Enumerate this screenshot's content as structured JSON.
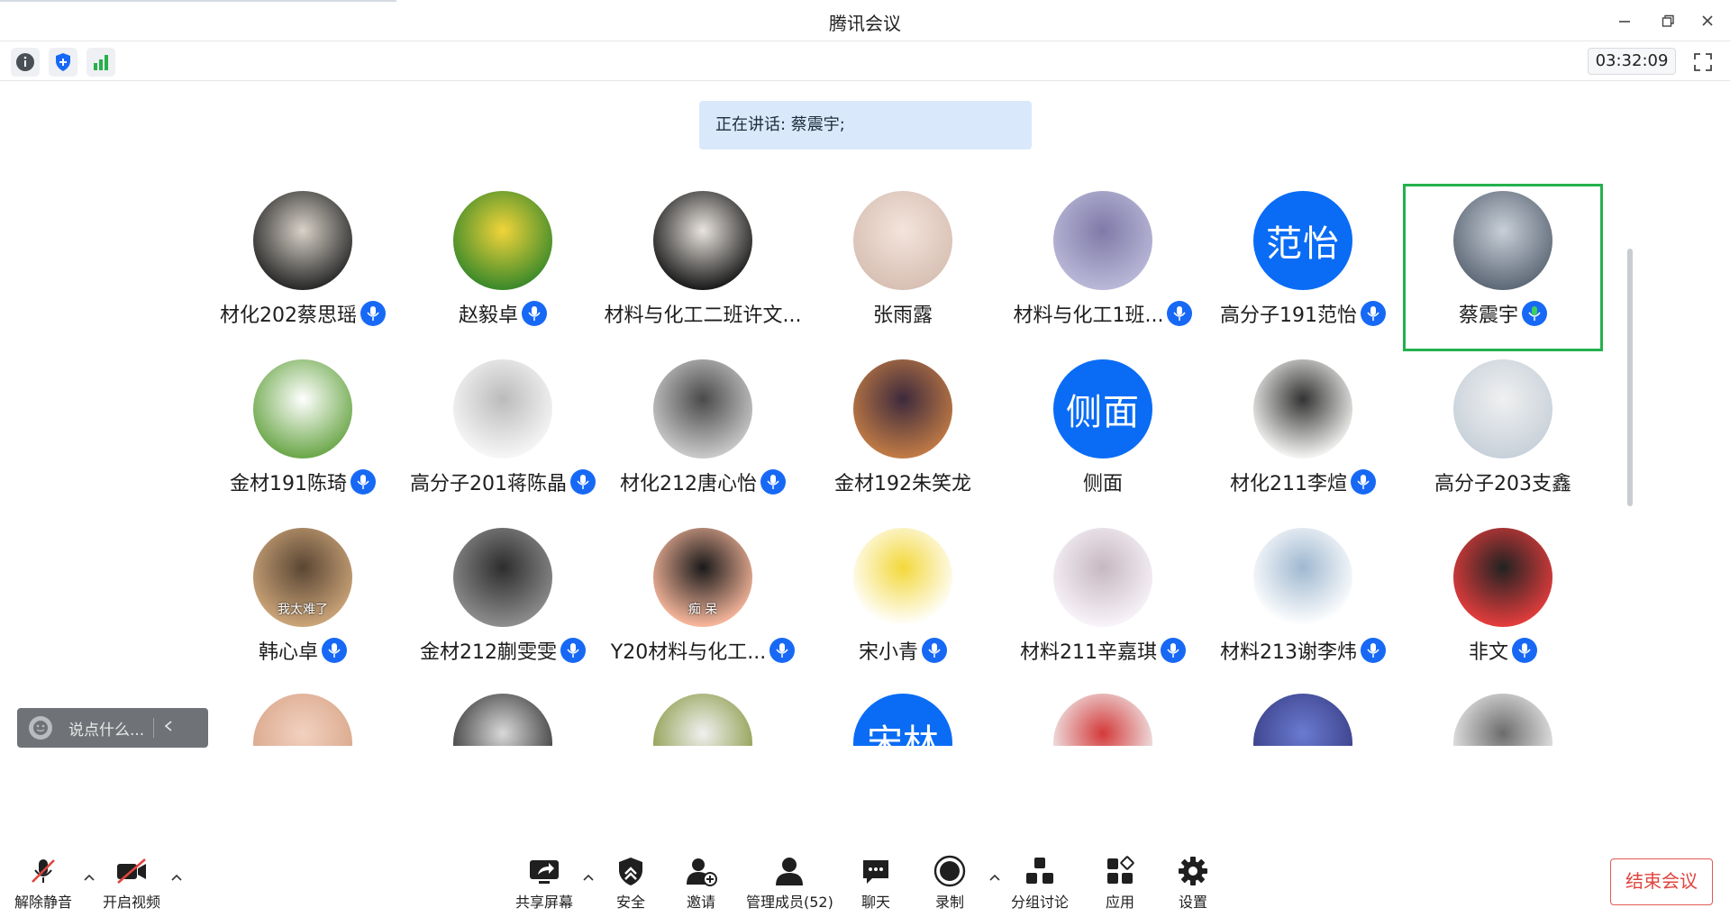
{
  "window": {
    "title": "腾讯会议"
  },
  "toolbar": {
    "timer": "03:32:09"
  },
  "speaking": {
    "text": "正在讲话: 蔡震宇;"
  },
  "participants": [
    {
      "name": "材化202蔡思瑶",
      "avatar": "photo",
      "mic": true
    },
    {
      "name": "赵毅卓",
      "avatar": "photo",
      "mic": true
    },
    {
      "name": "材料与化工二班许文...",
      "avatar": "photo",
      "mic": false
    },
    {
      "name": "张雨露",
      "avatar": "photo",
      "mic": false
    },
    {
      "name": "材料与化工1班...",
      "avatar": "photo",
      "mic": true
    },
    {
      "name": "高分子191范怡",
      "avatar": "text",
      "avatar_text": "范怡",
      "mic": true
    },
    {
      "name": "蔡震宇",
      "avatar": "photo",
      "mic": true,
      "speaking": true
    },
    {
      "name": "金材191陈琦",
      "avatar": "photo",
      "mic": true
    },
    {
      "name": "高分子201蒋陈晶",
      "avatar": "photo",
      "mic": true
    },
    {
      "name": "材化212唐心怡",
      "avatar": "photo",
      "mic": true
    },
    {
      "name": "金材192朱笑龙",
      "avatar": "photo",
      "mic": false
    },
    {
      "name": "侧面",
      "avatar": "text",
      "avatar_text": "侧面",
      "mic": false
    },
    {
      "name": "材化211李煊",
      "avatar": "photo",
      "mic": true
    },
    {
      "name": "高分子203支鑫",
      "avatar": "photo",
      "mic": false
    },
    {
      "name": "韩心卓",
      "avatar": "photo",
      "avatar_caption": "我太难了",
      "mic": true
    },
    {
      "name": "金材212蒯雯雯",
      "avatar": "photo",
      "mic": true
    },
    {
      "name": "Y20材料与化工...",
      "avatar": "photo",
      "avatar_caption": "痴 呆",
      "mic": true
    },
    {
      "name": "宋小青",
      "avatar": "photo",
      "mic": true
    },
    {
      "name": "材料211辛嘉琪",
      "avatar": "photo",
      "mic": true
    },
    {
      "name": "材料213谢李炜",
      "avatar": "photo",
      "mic": true
    },
    {
      "name": "非文",
      "avatar": "photo",
      "mic": true
    }
  ],
  "partial_row": [
    {
      "avatar": "photo"
    },
    {
      "avatar": "photo"
    },
    {
      "avatar": "photo"
    },
    {
      "avatar": "text",
      "avatar_text": "宋林"
    },
    {
      "avatar": "photo"
    },
    {
      "avatar": "photo"
    },
    {
      "avatar": "photo"
    }
  ],
  "chat_quick": {
    "placeholder": "说点什么..."
  },
  "controls": {
    "unmute": "解除静音",
    "start_video": "开启视频",
    "share_screen": "共享屏幕",
    "security": "安全",
    "invite": "邀请",
    "manage_members": "管理成员(52)",
    "chat": "聊天",
    "record": "录制",
    "breakout": "分组讨论",
    "apps": "应用",
    "settings": "设置",
    "end_meeting": "结束会议"
  },
  "colors": {
    "accent": "#1769f5",
    "speaking_border": "#23b14d",
    "end_red": "#e0443e",
    "banner": "#d9e9fb"
  }
}
